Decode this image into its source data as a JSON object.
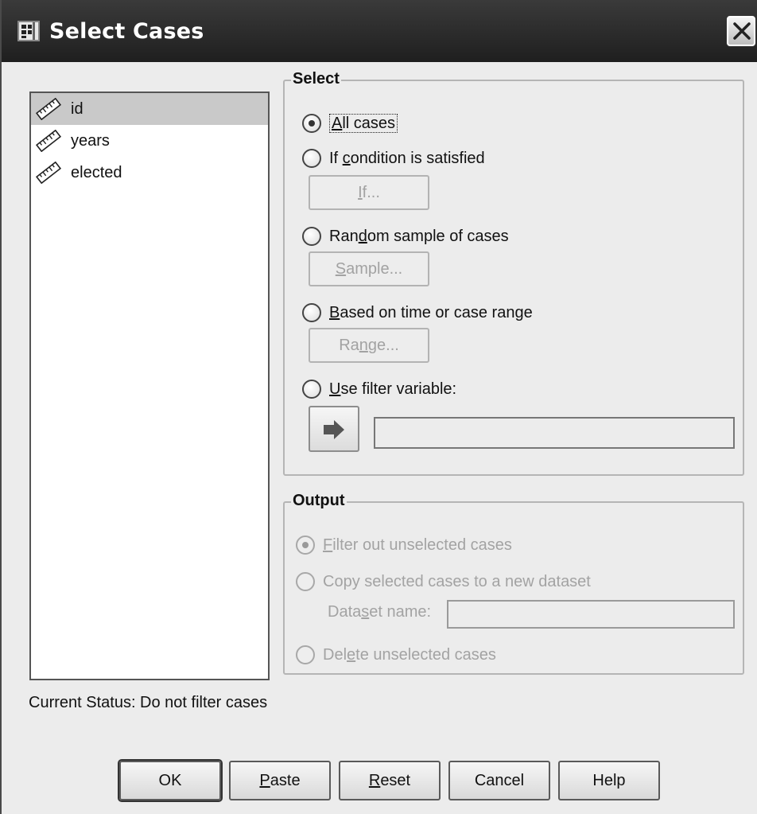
{
  "window": {
    "title": "Select Cases"
  },
  "variables": [
    {
      "label": "id",
      "selected": true
    },
    {
      "label": "years",
      "selected": false
    },
    {
      "label": "elected",
      "selected": false
    }
  ],
  "select": {
    "title": "Select",
    "options": {
      "all_cases": {
        "label": "All cases",
        "mnemonic": "A",
        "checked": true
      },
      "if_condition": {
        "pre": "If ",
        "mnemonic": "c",
        "post": "ondition is satisfied",
        "checked": false
      },
      "random_sample": {
        "pre": "Ran",
        "mnemonic": "d",
        "post": "om sample of cases",
        "checked": false
      },
      "time_range": {
        "pre": "",
        "mnemonic": "B",
        "post": "ased on time or case range",
        "checked": false
      },
      "filter_var": {
        "pre": "",
        "mnemonic": "U",
        "post": "se filter variable:",
        "checked": false
      }
    },
    "if_button": {
      "pre": "",
      "mnemonic": "I",
      "post": "f..."
    },
    "sample_button": {
      "pre": "",
      "mnemonic": "S",
      "post": "ample..."
    },
    "range_button": {
      "pre": "Ra",
      "mnemonic": "n",
      "post": "ge..."
    },
    "filter_value": ""
  },
  "output": {
    "title": "Output",
    "filter_out": {
      "pre": "",
      "mnemonic": "F",
      "post": "ilter out unselected cases",
      "checked": true
    },
    "copy_new": {
      "label": "Copy selected cases to a new dataset",
      "checked": false
    },
    "dataset_label": {
      "pre": "Data",
      "mnemonic": "s",
      "post": "et name:"
    },
    "dataset_value": "",
    "delete": {
      "pre": "Del",
      "mnemonic": "e",
      "post": "te unselected cases",
      "checked": false
    }
  },
  "status": "Current Status: Do not filter cases",
  "buttons": {
    "ok": {
      "label": "OK"
    },
    "paste": {
      "mnemonic": "P",
      "post": "aste"
    },
    "reset": {
      "mnemonic": "R",
      "post": "eset"
    },
    "cancel": {
      "label": "Cancel"
    },
    "help": {
      "label": "Help"
    }
  }
}
